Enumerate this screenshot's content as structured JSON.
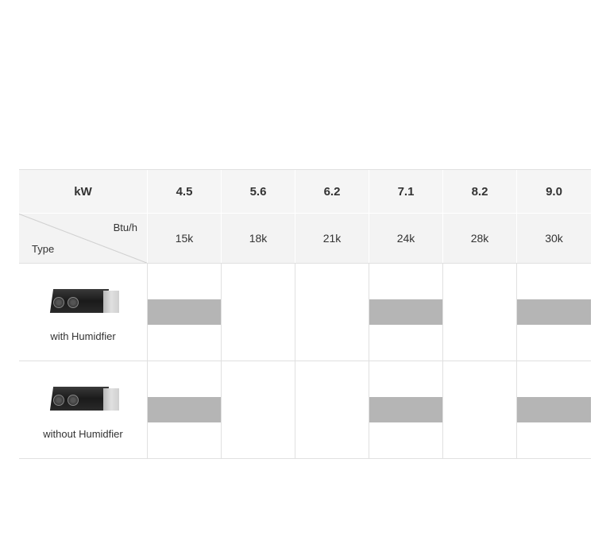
{
  "headers": {
    "kw_label": "kW",
    "btu_label": "Btu/h",
    "type_label": "Type",
    "kw_values": [
      "4.5",
      "5.6",
      "6.2",
      "7.1",
      "8.2",
      "9.0"
    ],
    "btu_values": [
      "15k",
      "18k",
      "21k",
      "24k",
      "28k",
      "30k"
    ]
  },
  "rows": [
    {
      "label": "with Humidfier",
      "availability": [
        true,
        false,
        false,
        true,
        false,
        true
      ]
    },
    {
      "label": "without Humidfier",
      "availability": [
        true,
        false,
        false,
        true,
        false,
        true
      ]
    }
  ]
}
